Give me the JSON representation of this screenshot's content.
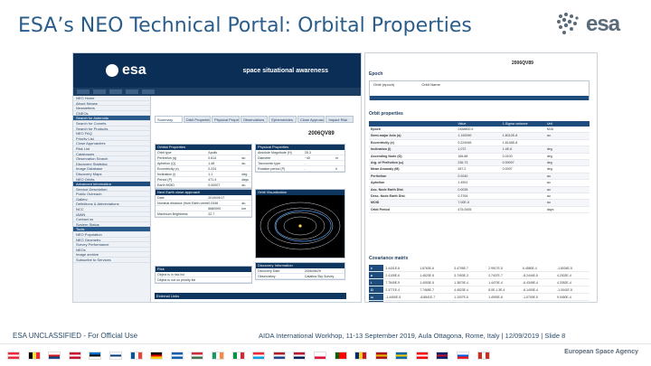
{
  "slide": {
    "title": "ESA’s NEO Technical Portal: Orbital Properties",
    "logo_text": "esa",
    "footer_left": "ESA UNCLASSIFIED - For Official Use",
    "footer_right": "AIDA International Workhop, 11-13 September 2019, Aula Ottagona, Rome, Italy | 12/09/2019 | Slide 8",
    "agency_name": "European Space Agency"
  },
  "portal": {
    "banner_logo": "esa",
    "banner_title": "space situational awareness",
    "object_name": "2006QV89",
    "tabs": [
      "Summary",
      "Orbit Properties",
      "Physical Properties",
      "Observations",
      "Ephemerides",
      "Close Approaches",
      "Impact Risk"
    ],
    "sidebar_items": [
      "NEO Home",
      "About Neows",
      "Newsletters",
      "CNEOs",
      "Search for Asteroids",
      "Search for Comets",
      "Search for Products",
      "NEO FAQ",
      "Priority List",
      "Close Approaches",
      "Risk List",
      "Catalogues",
      "Observation Search",
      "Discovery Statistics",
      "Image Database",
      "Discovery Maps",
      "NEO Orbits",
      "Advanced Information",
      "Service Description",
      "Public Outreach",
      "Gallery",
      "Definitions & Abbreviations",
      "NCC",
      "IAWN",
      "Contact us",
      "System Status",
      "Tools",
      "NEO Population",
      "NEO Geometry",
      "Survey Performance",
      "NEOs",
      "Image archive",
      "Subscribe to Services"
    ],
    "orbital_panel": {
      "title": "Orbital Properties",
      "rows": [
        [
          "Orbit type",
          "Apollo",
          ""
        ],
        [
          "Perihelion (q)",
          "0.814",
          "au"
        ],
        [
          "Aphelion (Q)",
          "1.48",
          "au"
        ],
        [
          "Eccentricity (e)",
          "0.224",
          ""
        ],
        [
          "Inclination (i)",
          "1.1",
          "deg"
        ],
        [
          "Period (P)",
          "471.4",
          "days"
        ],
        [
          "Earth MOID",
          "0.00007",
          "au"
        ]
      ]
    },
    "physical_panel": {
      "title": "Physical Properties",
      "rows": [
        [
          "Absolute Magnitude (H)",
          "25.3",
          ""
        ],
        [
          "Diameter",
          "~40",
          "m"
        ],
        [
          "Taxonomic type",
          "-",
          ""
        ],
        [
          "Rotation period (P)",
          "-",
          "h"
        ]
      ]
    },
    "orbit_viz_title": "Orbit Visualization",
    "close_approach_panel": {
      "title": "Next Earth close approach",
      "rows": [
        [
          "Date",
          "2019/09/17",
          ""
        ],
        [
          "Nominal distance (from Earth center)",
          "0.0446",
          "au"
        ],
        [
          "",
          "6680000",
          "km"
        ],
        [
          "Maximum Brightness",
          "22.7",
          ""
        ]
      ]
    },
    "risk_panel": {
      "title": "Risk",
      "rows": [
        [
          "Object is in risk list",
          "",
          ""
        ],
        [
          "Object is not on priority list",
          "",
          ""
        ]
      ]
    },
    "discovery_panel": {
      "title": "Discovery Information",
      "rows": [
        [
          "Discovery Date",
          "2006/08/29",
          ""
        ],
        [
          "Observatory",
          "Catalina Sky Survey",
          ""
        ]
      ]
    },
    "external_links": "External Links"
  },
  "orbit_doc": {
    "title": "2006QV89",
    "epoch_label": "Epoch",
    "epoch_options": [
      "Orbit (epoch)",
      "Orbit Name"
    ],
    "section_title": "Orbit properties",
    "columns": [
      "",
      "Value",
      "1-Sigma variance",
      "Unit"
    ],
    "rows": [
      [
        "Epoch",
        "2458600.5",
        "",
        "MJD"
      ],
      [
        "Semi-major Axis (a)",
        "1.192090",
        "1.8012E-8",
        "au"
      ],
      [
        "Eccentricity (e)",
        "0.224946",
        "1.8146E-8",
        ""
      ],
      [
        "Inclination (i)",
        "1.072",
        "1.4E-6",
        "deg"
      ],
      [
        "Ascending Node (Ω)",
        "166.88",
        "0.0100",
        "deg"
      ],
      [
        "Arg. of Perihelion (ω)",
        "236.73",
        "0.00097",
        "deg"
      ],
      [
        "Mean Anomaly (M)",
        "287.2",
        "0.0097",
        "deg"
      ],
      [
        "Perihelion",
        "0.9240",
        "",
        "au"
      ],
      [
        "Aphelion",
        "1.4591",
        "",
        "au"
      ],
      [
        "Asc. Node Earth Dist.",
        "0.0035",
        "",
        "au"
      ],
      [
        "Desc. Node Earth Dist.",
        "0.3764",
        "",
        "au"
      ],
      [
        "MOID",
        "7.00E-5",
        "",
        "au"
      ],
      [
        "Orbit Period",
        "475.0005",
        "",
        "days"
      ]
    ],
    "cov_title": "Covariance matrix",
    "cov_rows": [
      [
        "e",
        "3.4431E-8",
        "1.8763E-6",
        "3.4705E-7",
        "2.9917E-5",
        "6.4580E-4",
        "-1.8034E-5"
      ],
      [
        "a",
        "2.4105E-6",
        "1.4523E-5",
        "3.7053E-3",
        "2.7407E-7",
        "-8.2444E-5",
        "4.2302E-4"
      ],
      [
        "i",
        "7.7849E-9",
        "1.4093E-5",
        "1.3870E-4",
        "1.4470E-4",
        "-6.4349E-4",
        "4.2052E-4"
      ],
      [
        "Ω",
        "2.3771E-4",
        "7.7465E-7",
        "4.4523E-4",
        "8.0E-1.3E-4",
        "-6.1400E-4",
        "-1.0041E-5"
      ],
      [
        "ω",
        "-1.4450E-5",
        "-8.8841E-7",
        "1.1007E-5",
        "1.4993E-8",
        "-1.0700E-5",
        "9.0450E-4"
      ],
      [
        "M",
        "7.4300E-7",
        "6.2645E-7",
        "4.4004E-6",
        "4.9208E-5",
        "5.8613E-4",
        "1.0009E-4"
      ]
    ]
  },
  "flags": [
    {
      "name": "austria",
      "c1": "#ed2939",
      "c2": "#ffffff",
      "c3": "#ed2939",
      "dir": "h"
    },
    {
      "name": "belgium",
      "c1": "#000000",
      "c2": "#fae042",
      "c3": "#ed2939",
      "dir": "v"
    },
    {
      "name": "czech",
      "c1": "#ffffff",
      "c2": "#d7141a",
      "c3": "#11457e",
      "dir": "h"
    },
    {
      "name": "denmark",
      "c1": "#c8102e",
      "c2": "#ffffff",
      "c3": "#c8102e",
      "dir": "h"
    },
    {
      "name": "estonia",
      "c1": "#0072ce",
      "c2": "#000000",
      "c3": "#ffffff",
      "dir": "h"
    },
    {
      "name": "finland",
      "c1": "#ffffff",
      "c2": "#003580",
      "c3": "#ffffff",
      "dir": "h"
    },
    {
      "name": "france",
      "c1": "#0055a4",
      "c2": "#ffffff",
      "c3": "#ef4135",
      "dir": "v"
    },
    {
      "name": "germany",
      "c1": "#000000",
      "c2": "#dd0000",
      "c3": "#ffce00",
      "dir": "h"
    },
    {
      "name": "greece",
      "c1": "#0d5eaf",
      "c2": "#ffffff",
      "c3": "#0d5eaf",
      "dir": "h"
    },
    {
      "name": "hungary",
      "c1": "#ce2939",
      "c2": "#ffffff",
      "c3": "#477050",
      "dir": "h"
    },
    {
      "name": "ireland",
      "c1": "#169b62",
      "c2": "#ffffff",
      "c3": "#ff883e",
      "dir": "v"
    },
    {
      "name": "italy",
      "c1": "#009246",
      "c2": "#ffffff",
      "c3": "#ce2b37",
      "dir": "v"
    },
    {
      "name": "luxembourg",
      "c1": "#ed2939",
      "c2": "#ffffff",
      "c3": "#00a1de",
      "dir": "h"
    },
    {
      "name": "netherlands",
      "c1": "#ae1c28",
      "c2": "#ffffff",
      "c3": "#21468b",
      "dir": "h"
    },
    {
      "name": "norway",
      "c1": "#ba0c2f",
      "c2": "#ffffff",
      "c3": "#00205b",
      "dir": "h"
    },
    {
      "name": "poland",
      "c1": "#ffffff",
      "c2": "#ffffff",
      "c3": "#dc143c",
      "dir": "h"
    },
    {
      "name": "portugal",
      "c1": "#006600",
      "c2": "#ff0000",
      "c3": "#ff0000",
      "dir": "v"
    },
    {
      "name": "romania",
      "c1": "#002b7f",
      "c2": "#fcd116",
      "c3": "#ce1126",
      "dir": "v"
    },
    {
      "name": "spain",
      "c1": "#aa151b",
      "c2": "#f1bf00",
      "c3": "#aa151b",
      "dir": "h"
    },
    {
      "name": "sweden",
      "c1": "#006aa7",
      "c2": "#fecc00",
      "c3": "#006aa7",
      "dir": "h"
    },
    {
      "name": "switzerland",
      "c1": "#ff0000",
      "c2": "#ffffff",
      "c3": "#ff0000",
      "dir": "h"
    },
    {
      "name": "uk",
      "c1": "#012169",
      "c2": "#c8102e",
      "c3": "#012169",
      "dir": "h"
    },
    {
      "name": "slovenia",
      "c1": "#ffffff",
      "c2": "#005ce6",
      "c3": "#ed1c24",
      "dir": "h"
    },
    {
      "name": "canada",
      "c1": "#d52b1e",
      "c2": "#ffffff",
      "c3": "#d52b1e",
      "dir": "v"
    }
  ]
}
